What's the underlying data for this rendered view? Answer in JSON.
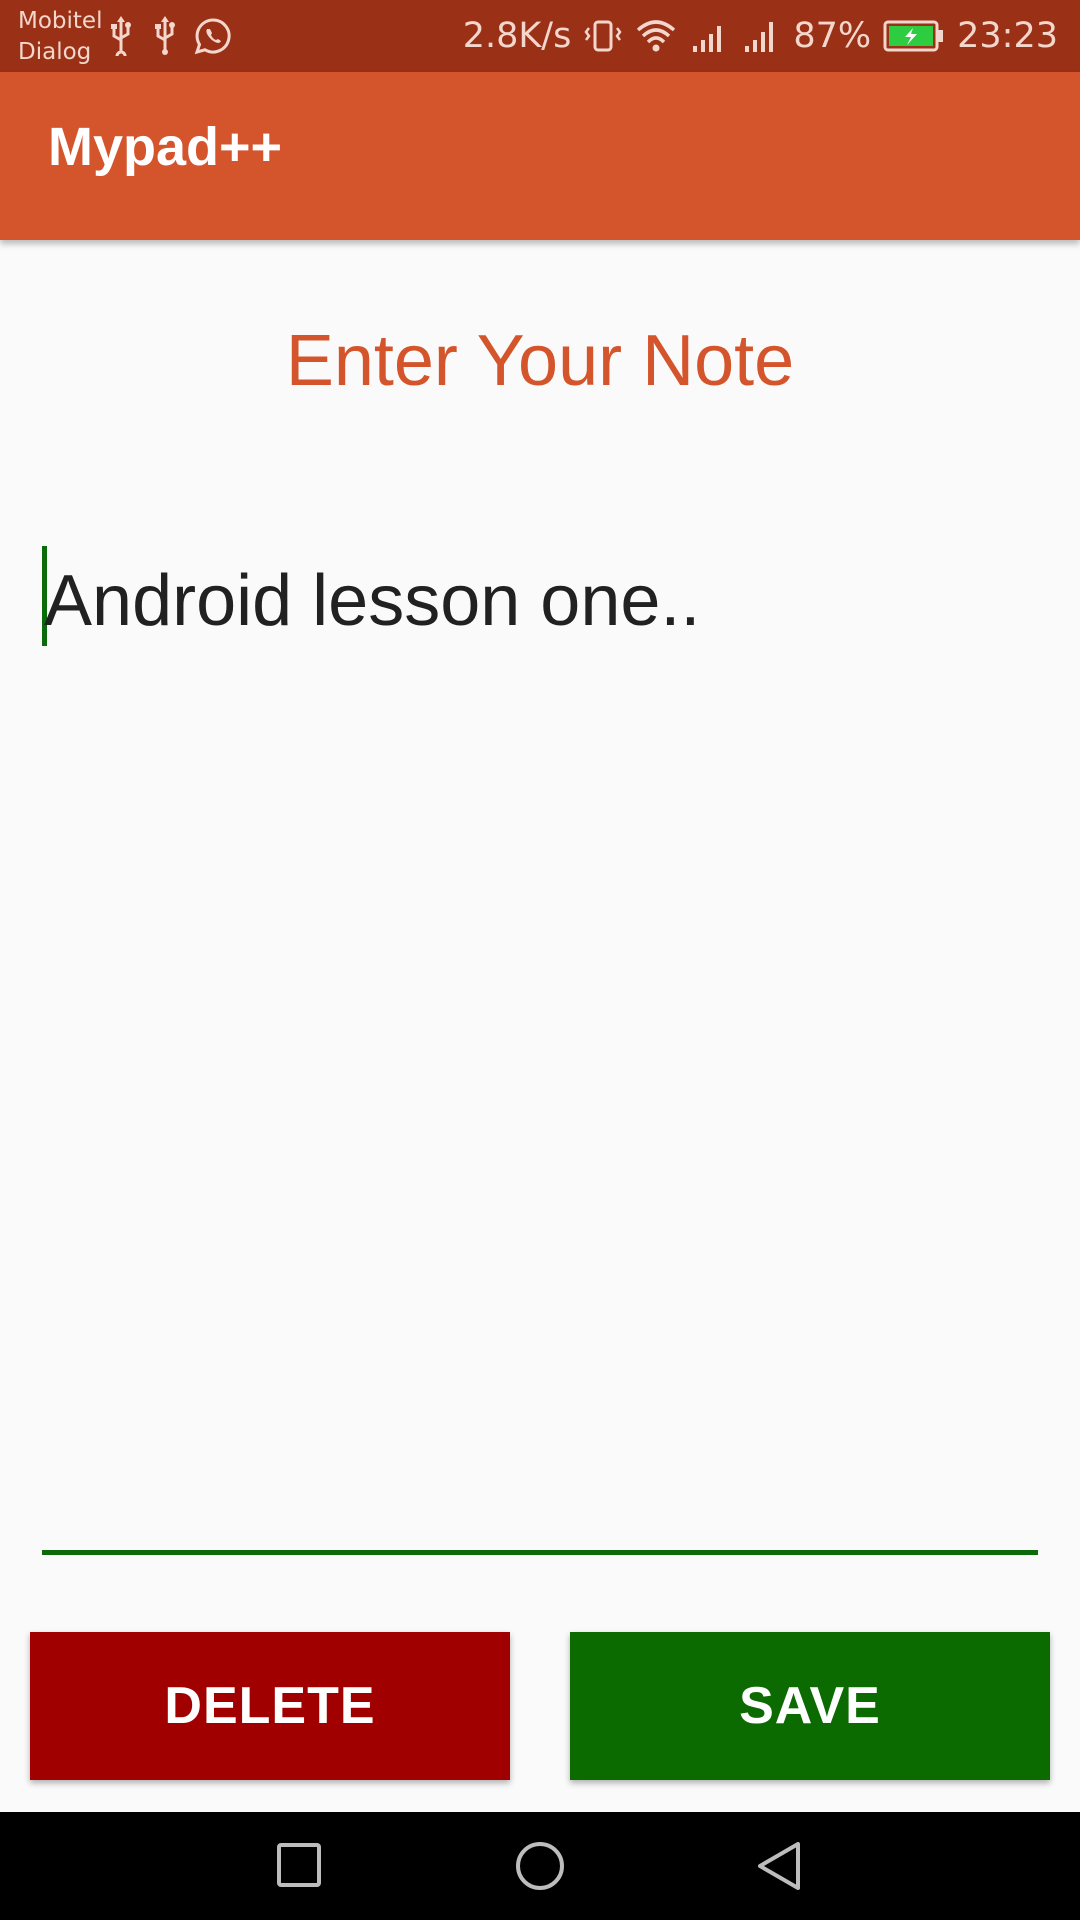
{
  "status_bar": {
    "carrier_line1": "Mobitel",
    "carrier_line2": "Dialog",
    "speed": "2.8K/s",
    "battery": "87%",
    "time": "23:23",
    "icons": [
      "usb-icon",
      "usb-icon",
      "whatsapp-icon",
      "vibrate-icon",
      "wifi-icon",
      "signal-icon",
      "signal-icon",
      "battery-charging-icon"
    ]
  },
  "app_bar": {
    "title": "Mypad++"
  },
  "main": {
    "heading": "Enter Your Note",
    "note_value": "Android lesson one.."
  },
  "actions": {
    "delete_label": "DELETE",
    "save_label": "SAVE"
  },
  "nav_bar": {
    "icons": [
      "recents-icon",
      "home-icon",
      "back-icon"
    ]
  },
  "colors": {
    "status_bar": "#9a3016",
    "app_bar": "#d4552c",
    "accent": "#0b6b0b",
    "delete": "#a10000",
    "save": "#0b6b00"
  }
}
